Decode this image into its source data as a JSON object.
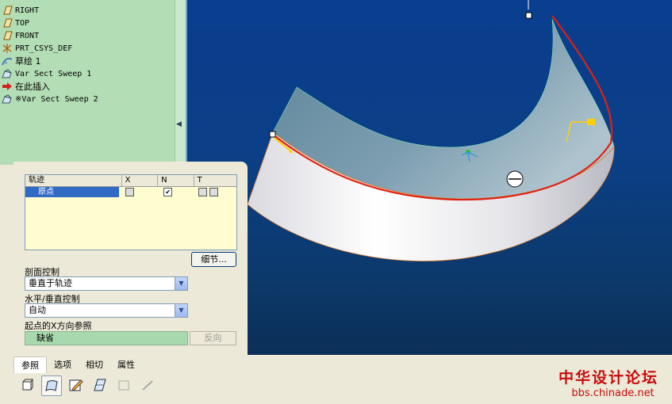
{
  "model_tree": {
    "items": [
      {
        "label": "RIGHT",
        "icon": "datum-plane-icon"
      },
      {
        "label": "TOP",
        "icon": "datum-plane-icon"
      },
      {
        "label": "FRONT",
        "icon": "datum-plane-icon"
      },
      {
        "label": "PRT_CSYS_DEF",
        "icon": "csys-icon"
      },
      {
        "label": "草绘 1",
        "icon": "sketch-icon"
      },
      {
        "label": "Var Sect Sweep 1",
        "icon": "sweep-icon"
      },
      {
        "label": "在此插入",
        "icon": "insert-here-arrow-icon"
      },
      {
        "label": "※Var Sect Sweep 2",
        "icon": "sweep-icon"
      }
    ]
  },
  "trajectory_table": {
    "headers": [
      "轨迹",
      "X",
      "N",
      "T"
    ],
    "rows": [
      {
        "name": "原点",
        "x_checked": false,
        "n_checked": true,
        "t_checked": false
      }
    ]
  },
  "details_button": "细节...",
  "section_control": {
    "label": "剖面控制",
    "value": "垂直于轨迹"
  },
  "hv_control": {
    "label": "水平/垂直控制",
    "value": "自动"
  },
  "x_direction": {
    "label": "起点的X方向参照",
    "value": "缺省",
    "flip_label": "反向"
  },
  "tabs": [
    {
      "label": "参照",
      "active": true
    },
    {
      "label": "选项",
      "active": false
    },
    {
      "label": "相切",
      "active": false
    },
    {
      "label": "属性",
      "active": false
    }
  ],
  "toolbar": [
    "solid-icon",
    "surface-icon",
    "sketch-edit-icon",
    "section-icon",
    "remove-material-icon",
    "thicken-icon"
  ],
  "watermark": {
    "title": "中华设计论坛",
    "url": "bbs.chinade.net"
  },
  "colors": {
    "tree_bg": "#b3ddb4",
    "viewport_bg": "#0a3e8f",
    "trajectory": "#e02010",
    "watermark": "#c70c0c"
  }
}
